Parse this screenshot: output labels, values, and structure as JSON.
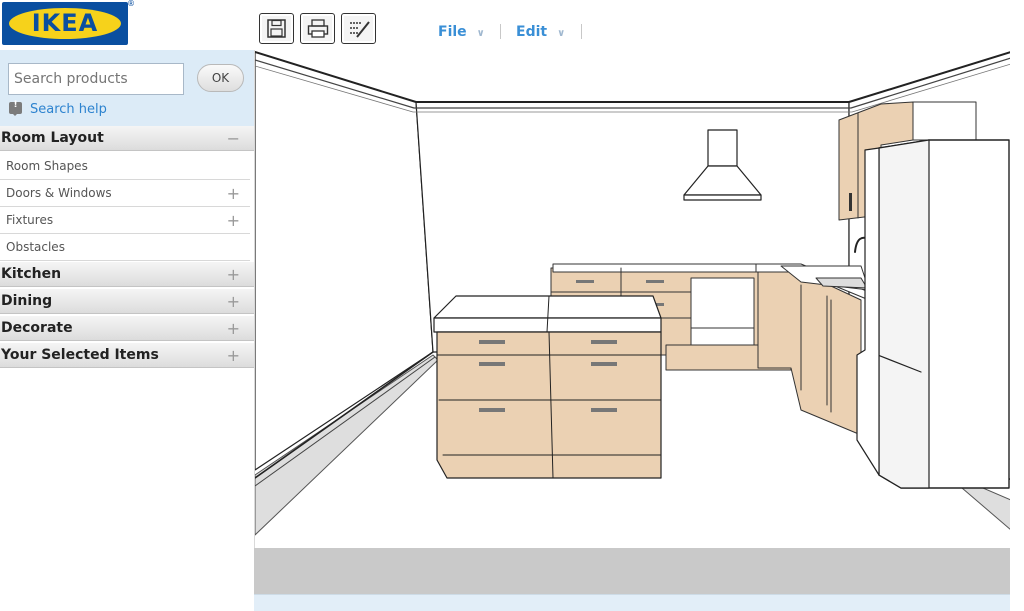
{
  "brand": {
    "logo_text": "IKEA",
    "registered": "®"
  },
  "toolbar": {
    "icons": [
      "save-icon",
      "print-icon",
      "edit-list-icon"
    ],
    "menus": [
      {
        "label": "File"
      },
      {
        "label": "Edit"
      }
    ]
  },
  "search": {
    "placeholder": "Search products",
    "button": "OK",
    "help": "Search help"
  },
  "categories": [
    {
      "label": "Room Layout",
      "state": "−",
      "items": [
        {
          "label": "Room Shapes",
          "sign": ""
        },
        {
          "label": "Doors & Windows",
          "sign": "+"
        },
        {
          "label": "Fixtures",
          "sign": "+"
        },
        {
          "label": "Obstacles",
          "sign": ""
        }
      ]
    },
    {
      "label": "Kitchen",
      "state": "+"
    },
    {
      "label": "Dining",
      "state": "+"
    },
    {
      "label": "Decorate",
      "state": "+"
    },
    {
      "label": "Your Selected Items",
      "state": "+"
    }
  ],
  "colors": {
    "ikea_blue": "#0a4fa0",
    "ikea_yellow": "#f6d21b",
    "link_blue": "#2d83cf",
    "cabinet_wood": "#ebd1b3"
  }
}
